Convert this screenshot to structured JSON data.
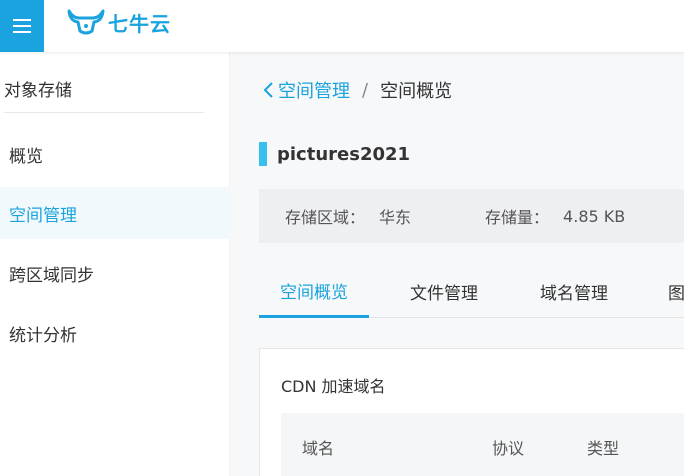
{
  "header": {
    "logo_text": "七牛云",
    "brand_color": "#1aa3de"
  },
  "sidebar": {
    "title": "对象存储",
    "items": [
      {
        "label": "概览",
        "active": false
      },
      {
        "label": "空间管理",
        "active": true
      },
      {
        "label": "跨区域同步",
        "active": false
      },
      {
        "label": "统计分析",
        "active": false
      }
    ]
  },
  "breadcrumb": {
    "back_label": "空间管理",
    "separator": "/",
    "current": "空间概览"
  },
  "bucket": {
    "name": "pictures2021",
    "region_label": "存储区域：",
    "region_value": "华东",
    "usage_label": "存储量：",
    "usage_value": "4.85 KB"
  },
  "tabs": [
    {
      "label": "空间概览",
      "active": true
    },
    {
      "label": "文件管理",
      "active": false
    },
    {
      "label": "域名管理",
      "active": false
    },
    {
      "label": "图",
      "active": false
    }
  ],
  "cdn": {
    "title": "CDN 加速域名",
    "columns": [
      "域名",
      "协议",
      "类型"
    ]
  }
}
